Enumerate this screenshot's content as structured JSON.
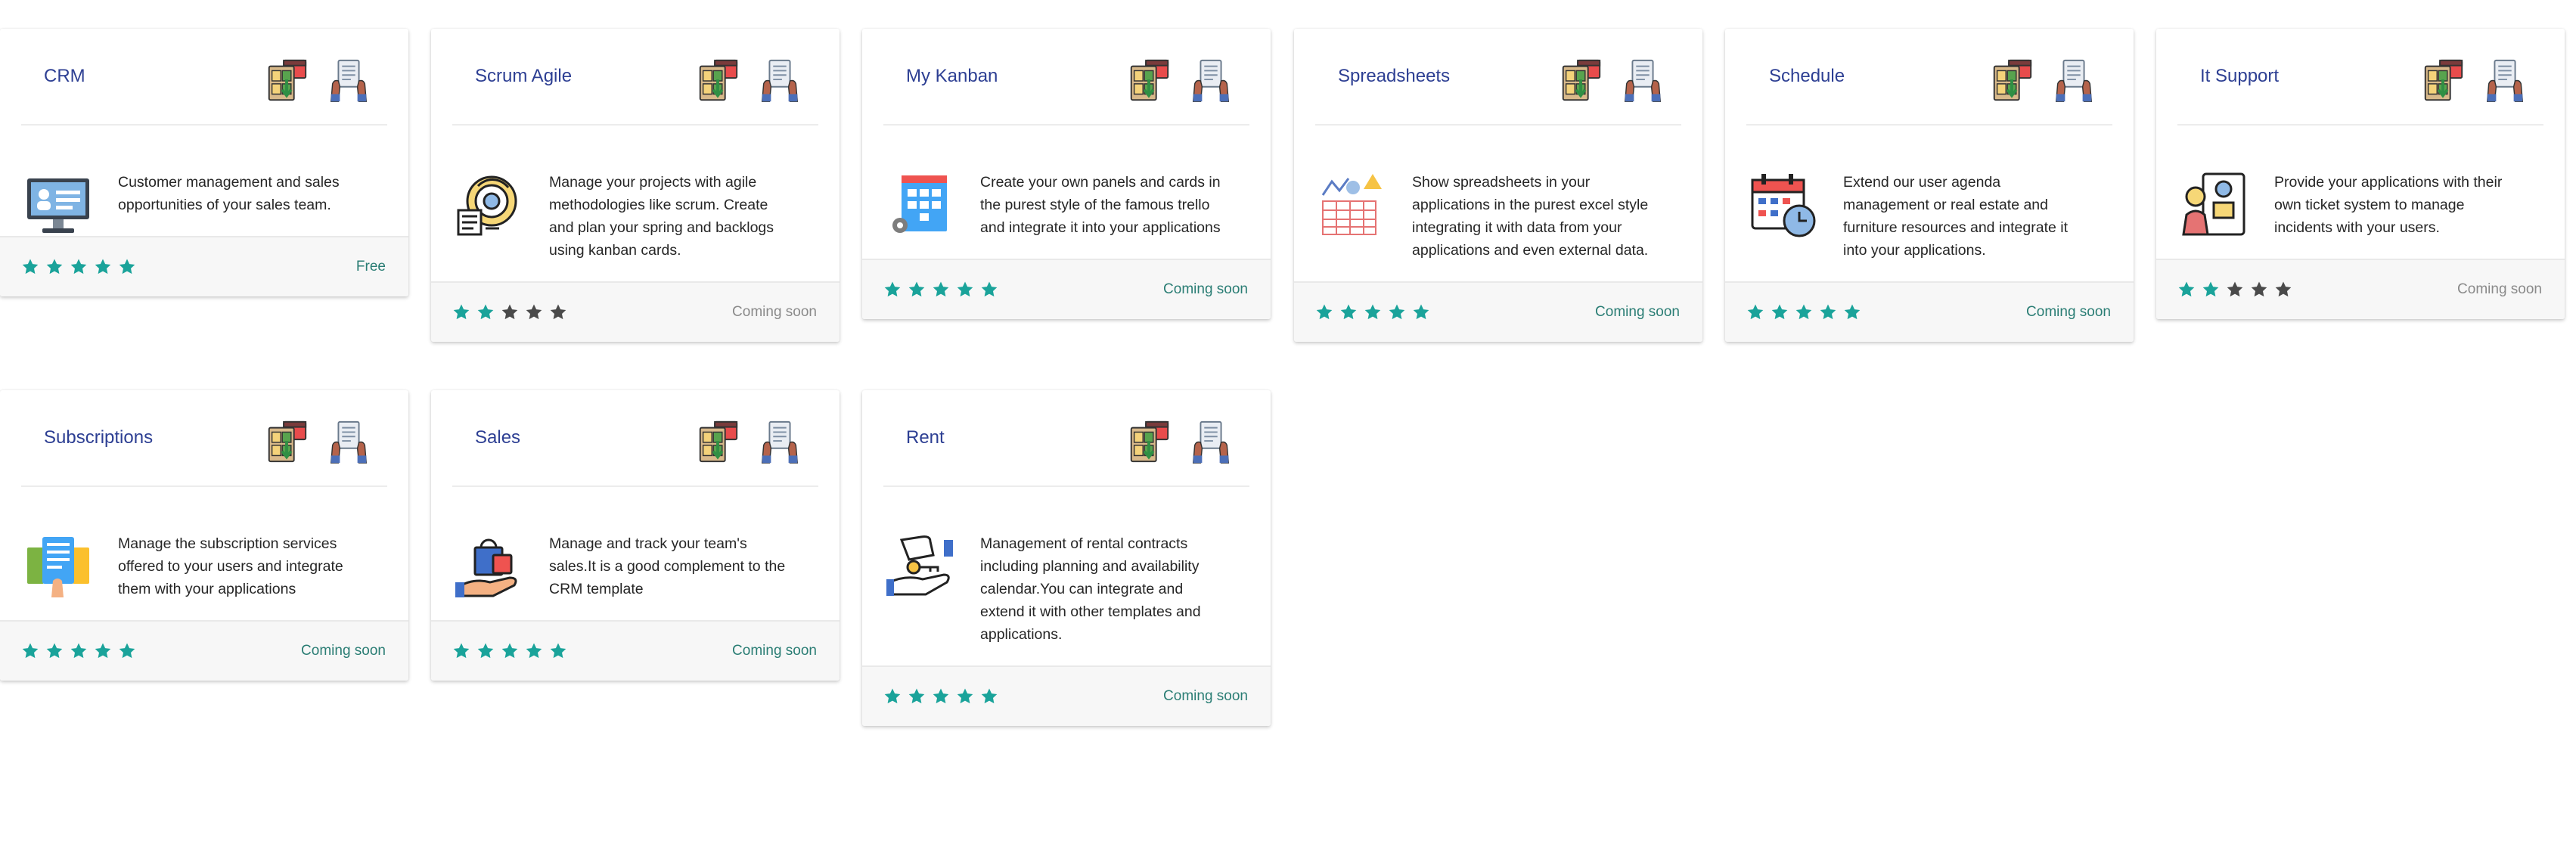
{
  "colors": {
    "title": "#2d3f93",
    "star_active": "#1aa39a",
    "star_inactive": "#4a4a4a",
    "status_available": "#2a7d74",
    "status_grey": "#8a8a8a"
  },
  "card_tools": [
    "install-template-icon",
    "template-info-icon"
  ],
  "cards": [
    {
      "title": "CRM",
      "description": "Customer management and sales opportunities of your sales team.",
      "rating": 5,
      "status": "Free",
      "icon": "monitor-contacts-icon"
    },
    {
      "title": "Scrum Agile",
      "description": "Manage your projects with agile methodologies like scrum. Create and plan your spring and backlogs using kanban cards.",
      "rating": 2,
      "status": "Coming soon",
      "icon": "agile-target-icon"
    },
    {
      "title": "My Kanban",
      "description": "Create your own panels and cards in the purest style of the famous trello and integrate it into your applications",
      "rating": 5,
      "status": "Coming soon",
      "icon": "kanban-board-icon"
    },
    {
      "title": "Spreadsheets",
      "description": "Show spreadsheets in your applications in the purest excel style integrating it with data from your applications and even external data.",
      "rating": 5,
      "status": "Coming soon",
      "icon": "spreadsheet-chart-icon"
    },
    {
      "title": "Schedule",
      "description": "Extend our user agenda management or real estate and furniture resources and integrate it into your applications.",
      "rating": 5,
      "status": "Coming soon",
      "icon": "calendar-clock-icon"
    },
    {
      "title": "It Support",
      "description": "Provide your applications with their own ticket system to manage incidents with your users.",
      "rating": 2,
      "status": "Coming soon",
      "icon": "support-ticket-icon"
    },
    {
      "title": "Subscriptions",
      "description": "Manage the subscription services offered to your users and integrate them with your applications",
      "rating": 5,
      "status": "Coming soon",
      "icon": "subscription-cards-icon"
    },
    {
      "title": "Sales",
      "description": "Manage and track your team's sales.It is a good complement to the CRM template",
      "rating": 5,
      "status": "Coming soon",
      "icon": "shopping-bag-hand-icon"
    },
    {
      "title": "Rent",
      "description": "Management of rental contracts including planning and availability calendar.You can integrate and extend it with other templates and applications.",
      "rating": 5,
      "status": "Coming soon",
      "icon": "rental-key-hand-icon"
    }
  ]
}
